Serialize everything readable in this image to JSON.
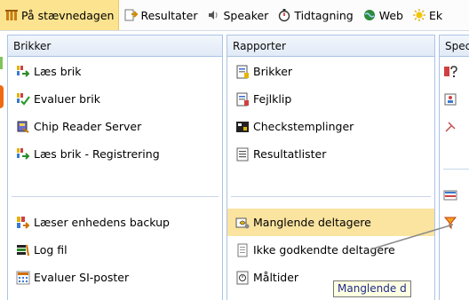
{
  "menubar": {
    "items": [
      {
        "label": "På stævnedagen",
        "icon": "event-icon",
        "active": true
      },
      {
        "label": "Resultater",
        "icon": "results-icon",
        "active": false
      },
      {
        "label": "Speaker",
        "icon": "speaker-icon",
        "active": false
      },
      {
        "label": "Tidtagning",
        "icon": "stopwatch-icon",
        "active": false
      },
      {
        "label": "Web",
        "icon": "globe-icon",
        "active": false
      },
      {
        "label": "Ek",
        "icon": "sun-icon",
        "active": false
      }
    ]
  },
  "panels": {
    "brikker": {
      "title": "Brikker",
      "items": [
        {
          "label": "Læs brik",
          "icon": "read-card-icon"
        },
        {
          "label": "Evaluer brik",
          "icon": "evaluate-card-icon"
        },
        {
          "label": "Chip Reader Server",
          "icon": "chip-reader-icon"
        },
        {
          "label": "Læs brik - Registrering",
          "icon": "read-card-register-icon"
        },
        {
          "label": "Læser enhedens backup",
          "icon": "backup-icon"
        },
        {
          "label": "Log fil",
          "icon": "log-file-icon"
        },
        {
          "label": "Evaluer SI-poster",
          "icon": "si-posts-icon"
        }
      ]
    },
    "rapporter": {
      "title": "Rapporter",
      "items": [
        {
          "label": "Brikker",
          "icon": "cards-report-icon"
        },
        {
          "label": "Fejlklip",
          "icon": "error-punch-icon"
        },
        {
          "label": "Checkstemplinger",
          "icon": "check-punch-icon"
        },
        {
          "label": "Resultatlister",
          "icon": "result-list-icon"
        },
        {
          "label": "Manglende deltagere",
          "icon": "missing-participants-icon"
        },
        {
          "label": "Ikke godkendte deltagere",
          "icon": "document-icon"
        },
        {
          "label": "Måltider",
          "icon": "finish-times-icon"
        }
      ]
    },
    "special": {
      "title": "Spec"
    }
  },
  "tooltip": {
    "text": "Manglende d"
  },
  "colors": {
    "accent": "#fce38f",
    "hover": "#fbe4a0",
    "panel_border": "#aac3e6",
    "tooltip_bg": "#ffffe1"
  }
}
